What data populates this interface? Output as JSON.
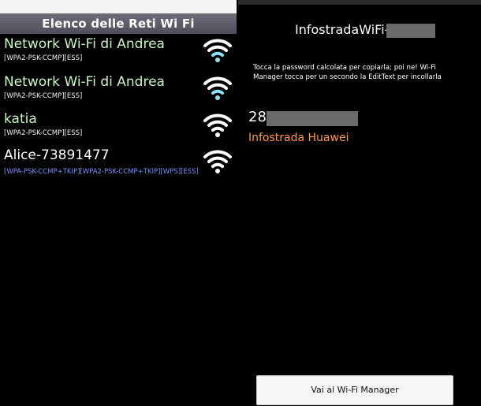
{
  "wifi_list": {
    "header": "Elenco delle Reti Wi Fi",
    "networks": [
      {
        "ssid": "Network Wi-Fi di Andrea",
        "security": "[WPA2-PSK-CCMP][ESS]",
        "icon": "wifi-signal-icon"
      },
      {
        "ssid": "Network Wi-Fi di Andrea",
        "security": "[WPA2-PSK-CCMP][ESS]",
        "icon": "wifi-signal-icon"
      },
      {
        "ssid": "katia",
        "security": "[WPA2-PSK-CCMP][ESS]",
        "icon": "wifi-signal-icon"
      },
      {
        "ssid": "Alice-73891477",
        "security": "[WPA-PSK-CCMP+TKIP][WPA2-PSK-CCMP+TKIP][WPS][ESS]",
        "icon": "wifi-signal-icon"
      }
    ]
  },
  "detail": {
    "title": "InfostradaWiFi-",
    "instructions": "Tocca la password calcolata per copiarla;              poi ne! Wi-Fi Manager tocca per un secondo la EditText per incollarla",
    "password": "28",
    "model": "Infostrada Huawei",
    "button_label": "Vai al Wi-Fi Manager"
  },
  "colors": {
    "ssid_green": "#c9f7c2",
    "security_blue": "#7f8dff",
    "model_orange": "#ff9a3c",
    "wifi_icon_cyan": "#86e1f2"
  }
}
